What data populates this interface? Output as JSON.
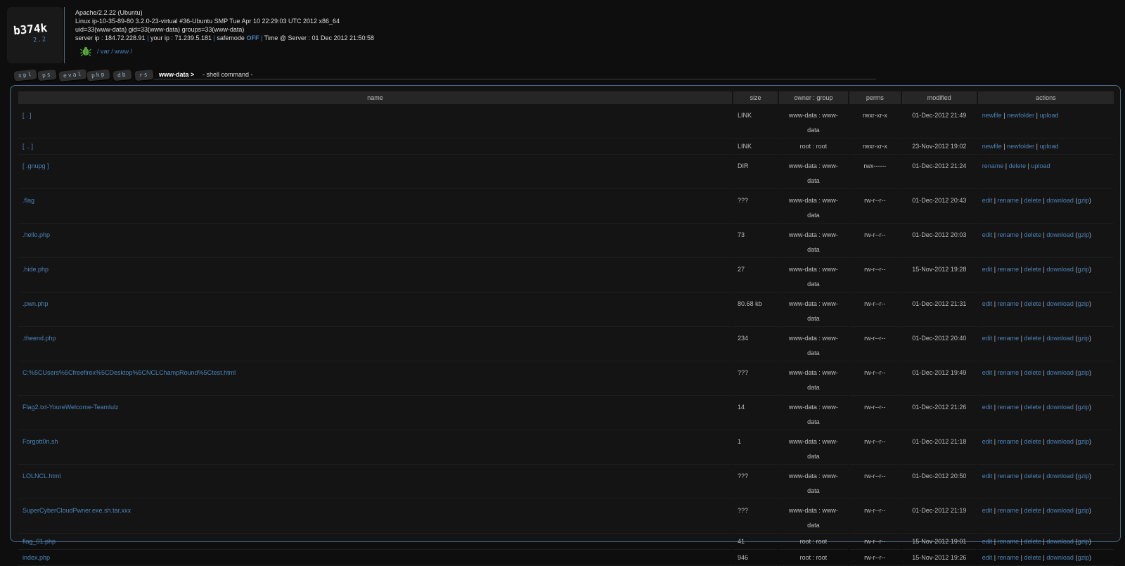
{
  "logo": {
    "name": "b374k",
    "version": "2.2"
  },
  "info": {
    "server_software": "Apache/2.2.22 (Ubuntu)",
    "uname": "Linux ip-10-35-89-80 3.2.0-23-virtual #36-Ubuntu SMP Tue Apr 10 22:29:03 UTC 2012 x86_64",
    "ids": "uid=33(www-data) gid=33(www-data) groups=33(www-data)",
    "server_ip_label": "server ip : 184.72.228.91",
    "sep": "|",
    "your_ip_label": "your ip : 71.239.5.181",
    "safemode_label": "safemode",
    "safemode_value": "OFF",
    "time_label": "Time @ Server : 01 Dec 2012 21:50:58"
  },
  "path": {
    "p0": "/",
    "p1": "var",
    "p2": "/",
    "p3": "www",
    "p4": "/"
  },
  "menu": {
    "tabs": [
      "xpl",
      "ps",
      "eval",
      "php",
      "db",
      "rs"
    ],
    "prompt": "www-data >",
    "command": "- shell command -"
  },
  "table": {
    "headers": {
      "name": "name",
      "size": "size",
      "owner": "owner : group",
      "perms": "perms",
      "modified": "modified",
      "actions": "actions"
    },
    "action_labels": {
      "newfile": "newfile",
      "newfolder": "newfolder",
      "upload": "upload",
      "rename": "rename",
      "delete": "delete",
      "edit": "edit",
      "download": "download",
      "gzip": "gzip",
      "pipe": "|",
      "open_paren": "(",
      "close_paren": ")"
    },
    "rows": [
      {
        "name": "[ . ]",
        "size": "LINK",
        "owner": "www-data : www-data",
        "perms": "rwxr-xr-x",
        "modified": "01-Dec-2012 21:49"
      },
      {
        "name": "[ .. ]",
        "size": "LINK",
        "owner": "root : root",
        "perms": "rwxr-xr-x",
        "modified": "23-Nov-2012 19:02"
      },
      {
        "name": "[ .gnupg ]",
        "size": "DIR",
        "owner": "www-data : www-data",
        "perms": "rwx------",
        "modified": "01-Dec-2012 21:24"
      },
      {
        "name": ".flag",
        "size": "???",
        "owner": "www-data : www-data",
        "perms": "rw-r--r--",
        "modified": "01-Dec-2012 20:43"
      },
      {
        "name": ".hello.php",
        "size": "73",
        "owner": "www-data : www-data",
        "perms": "rw-r--r--",
        "modified": "01-Dec-2012 20:03"
      },
      {
        "name": ".hide.php",
        "size": "27",
        "owner": "www-data : www-data",
        "perms": "rw-r--r--",
        "modified": "15-Nov-2012 19:28"
      },
      {
        "name": ".pwn.php",
        "size": "80.68 kb",
        "owner": "www-data : www-data",
        "perms": "rw-r--r--",
        "modified": "01-Dec-2012 21:31"
      },
      {
        "name": ".theend.php",
        "size": "234",
        "owner": "www-data : www-data",
        "perms": "rw-r--r--",
        "modified": "01-Dec-2012 20:40"
      },
      {
        "name": "C:%5CUsers%5Cfreefirex%5CDesktop%5CNCLChampRound%5Ctest.html",
        "size": "???",
        "owner": "www-data : www-data",
        "perms": "rw-r--r--",
        "modified": "01-Dec-2012 19:49"
      },
      {
        "name": "Flag2.txt-YoureWelcome-Teamlulz",
        "size": "14",
        "owner": "www-data : www-data",
        "perms": "rw-r--r--",
        "modified": "01-Dec-2012 21:26"
      },
      {
        "name": "Forgott0n.sh",
        "size": "1",
        "owner": "www-data : www-data",
        "perms": "rw-r--r--",
        "modified": "01-Dec-2012 21:18"
      },
      {
        "name": "LOLNCL.html",
        "size": "???",
        "owner": "www-data : www-data",
        "perms": "rw-r--r--",
        "modified": "01-Dec-2012 20:50"
      },
      {
        "name": "SuperCyberCloudPwner.exe.sh.tar.xxx",
        "size": "???",
        "owner": "www-data : www-data",
        "perms": "rw-r--r--",
        "modified": "01-Dec-2012 21:19"
      },
      {
        "name": "flag_01.php",
        "size": "41",
        "owner": "root : root",
        "perms": "rw-r--r--",
        "modified": "15-Nov-2012 19:01"
      },
      {
        "name": "index.php",
        "size": "946",
        "owner": "root : root",
        "perms": "rw-r--r--",
        "modified": "15-Nov-2012 19:26"
      }
    ]
  },
  "colors": {
    "accent": "#4b83b8",
    "background": "#0e0e0e",
    "panel_border": "#4a6f8f"
  },
  "icons": {
    "bug": "bug-icon"
  }
}
